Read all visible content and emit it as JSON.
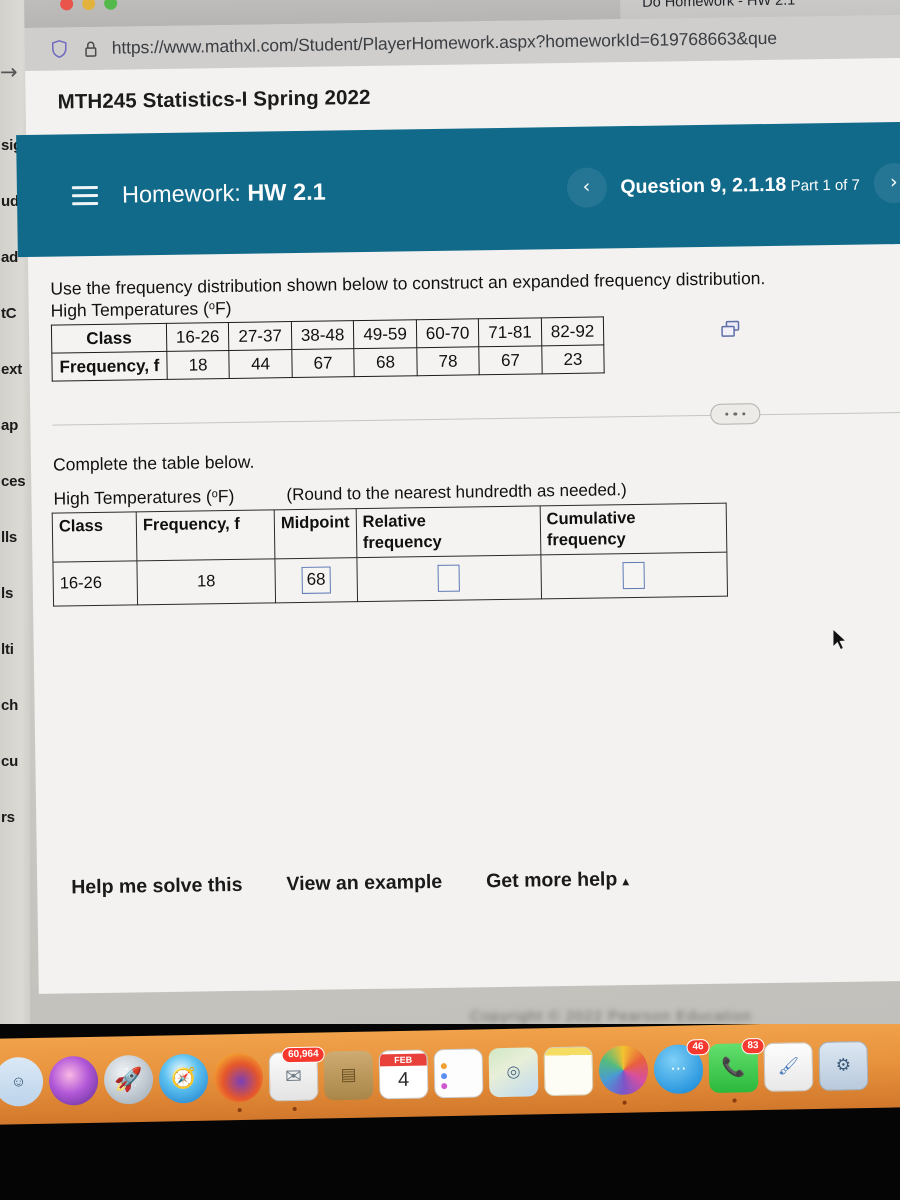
{
  "window": {
    "tab_title": "Do Homework - HW 2.1",
    "url": "https://www.mathxl.com/Student/PlayerHomework.aspx?homeworkId=619768663&que",
    "shield_icon": "shield-icon",
    "lock_icon": "lock-icon",
    "traffic_lights": [
      "close-red",
      "minimize-yellow",
      "maximize-green"
    ]
  },
  "background_nav": {
    "fragments": [
      "sig",
      "udy",
      "ad",
      "tC",
      "ext",
      "ap",
      "ces",
      "lls",
      "ls",
      "lti",
      "ch",
      "cu",
      "rs"
    ],
    "back_arrow": "→"
  },
  "page": {
    "course_title": "MTH245 Statistics-I Spring 2022"
  },
  "header": {
    "menu_icon": "hamburger-menu-icon",
    "label": "Homework:",
    "assignment": "HW 2.1",
    "prev_icon": "‹",
    "next_icon": "›",
    "question": "Question 9, 2.1.18",
    "part": "Part 1 of 7",
    "accent_color": "#116a8a"
  },
  "problem": {
    "prompt": "Use the frequency distribution shown below to construct an expanded frequency distribution.",
    "given_table_caption": "High Temperatures (",
    "given_table_caption_unit": "o",
    "given_table_caption_end": "F)",
    "copy_icon": "copy-to-spreadsheet-icon",
    "given_table": {
      "row_headers": [
        "Class",
        "Frequency, f"
      ],
      "classes": [
        "16-26",
        "27-37",
        "38-48",
        "49-59",
        "60-70",
        "71-81",
        "82-92"
      ],
      "frequencies": [
        "18",
        "44",
        "67",
        "68",
        "78",
        "67",
        "23"
      ]
    },
    "ellipsis_icon": "more-options-icon",
    "sub_instruction": "Complete the table below.",
    "answer_table_caption": "High Temperatures (",
    "answer_table_caption_unit": "o",
    "answer_table_caption_end": "F)",
    "rounding_note": "(Round to the nearest hundredth as needed.)",
    "answer_table": {
      "columns": [
        "Class",
        "Frequency, f",
        "Midpoint",
        "Relative frequency",
        "Cumulative frequency"
      ],
      "column_relative_line1": "Relative",
      "column_relative_line2": "frequency",
      "column_cumulative_line1": "Cumulative",
      "column_cumulative_line2": "frequency",
      "rows": [
        {
          "class": "16-26",
          "frequency": "18",
          "midpoint_value": "68",
          "relative_frequency_value": "",
          "cumulative_frequency_value": ""
        }
      ],
      "input_border_color": "#5d7ab5"
    }
  },
  "help": {
    "solve": "Help me solve this",
    "example": "View an example",
    "more": "Get more help",
    "more_caret": "▴"
  },
  "dock": {
    "items": [
      {
        "name": "finder",
        "badge": ""
      },
      {
        "name": "siri",
        "badge": ""
      },
      {
        "name": "launchpad",
        "badge": ""
      },
      {
        "name": "safari",
        "badge": ""
      },
      {
        "name": "firefox",
        "badge": ""
      },
      {
        "name": "mail",
        "badge": "60,964"
      },
      {
        "name": "downloads-folder",
        "badge": ""
      },
      {
        "name": "calendar",
        "badge": ""
      },
      {
        "name": "reminders",
        "badge": ""
      },
      {
        "name": "maps",
        "badge": ""
      },
      {
        "name": "notes",
        "badge": ""
      },
      {
        "name": "photos",
        "badge": ""
      },
      {
        "name": "messages",
        "badge": "46"
      },
      {
        "name": "facetime",
        "badge": "83"
      },
      {
        "name": "preview",
        "badge": ""
      },
      {
        "name": "system-preferences",
        "badge": ""
      }
    ],
    "calendar_month": "FEB",
    "calendar_day": "4"
  }
}
